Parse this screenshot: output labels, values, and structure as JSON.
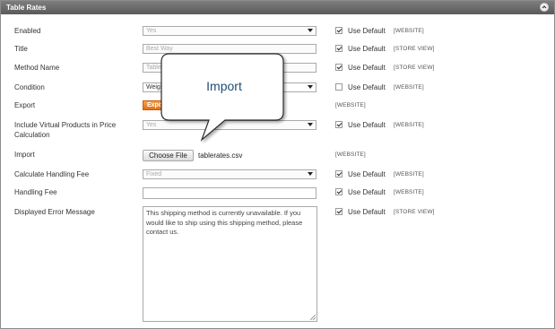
{
  "panel": {
    "title": "Table Rates"
  },
  "callout": {
    "text": "Import"
  },
  "use_default_label": "Use Default",
  "rows": {
    "enabled": {
      "label": "Enabled",
      "value": "Yes",
      "scope": "[WEBSITE]",
      "use_default": true
    },
    "title": {
      "label": "Title",
      "value": "Best Way",
      "scope": "[STORE VIEW]",
      "use_default": true
    },
    "method_name": {
      "label": "Method Name",
      "value": "Table Rate",
      "scope": "[STORE VIEW]",
      "use_default": true
    },
    "condition": {
      "label": "Condition",
      "value": "Weight vs. Destination",
      "scope": "[WEBSITE]",
      "use_default": false
    },
    "export": {
      "label": "Export",
      "button": "Export CSV",
      "scope": "[WEBSITE]"
    },
    "virtual": {
      "label": "Include Virtual Products in Price Calculation",
      "value": "Yes",
      "scope": "[WEBSITE]",
      "use_default": true
    },
    "import": {
      "label": "Import",
      "button": "Choose File",
      "file": "tablerates.csv",
      "scope": "[WEBSITE]"
    },
    "handling_fee_calc": {
      "label": "Calculate Handling Fee",
      "value": "Fixed",
      "scope": "[WEBSITE]",
      "use_default": true
    },
    "handling_fee": {
      "label": "Handling Fee",
      "value": "",
      "scope": "[WEBSITE]",
      "use_default": true
    },
    "error_message": {
      "label": "Displayed Error Message",
      "value": "This shipping method is currently unavailable. If you would like to ship using this shipping method, please contact us.",
      "scope": "[STORE VIEW]",
      "use_default": true
    }
  }
}
